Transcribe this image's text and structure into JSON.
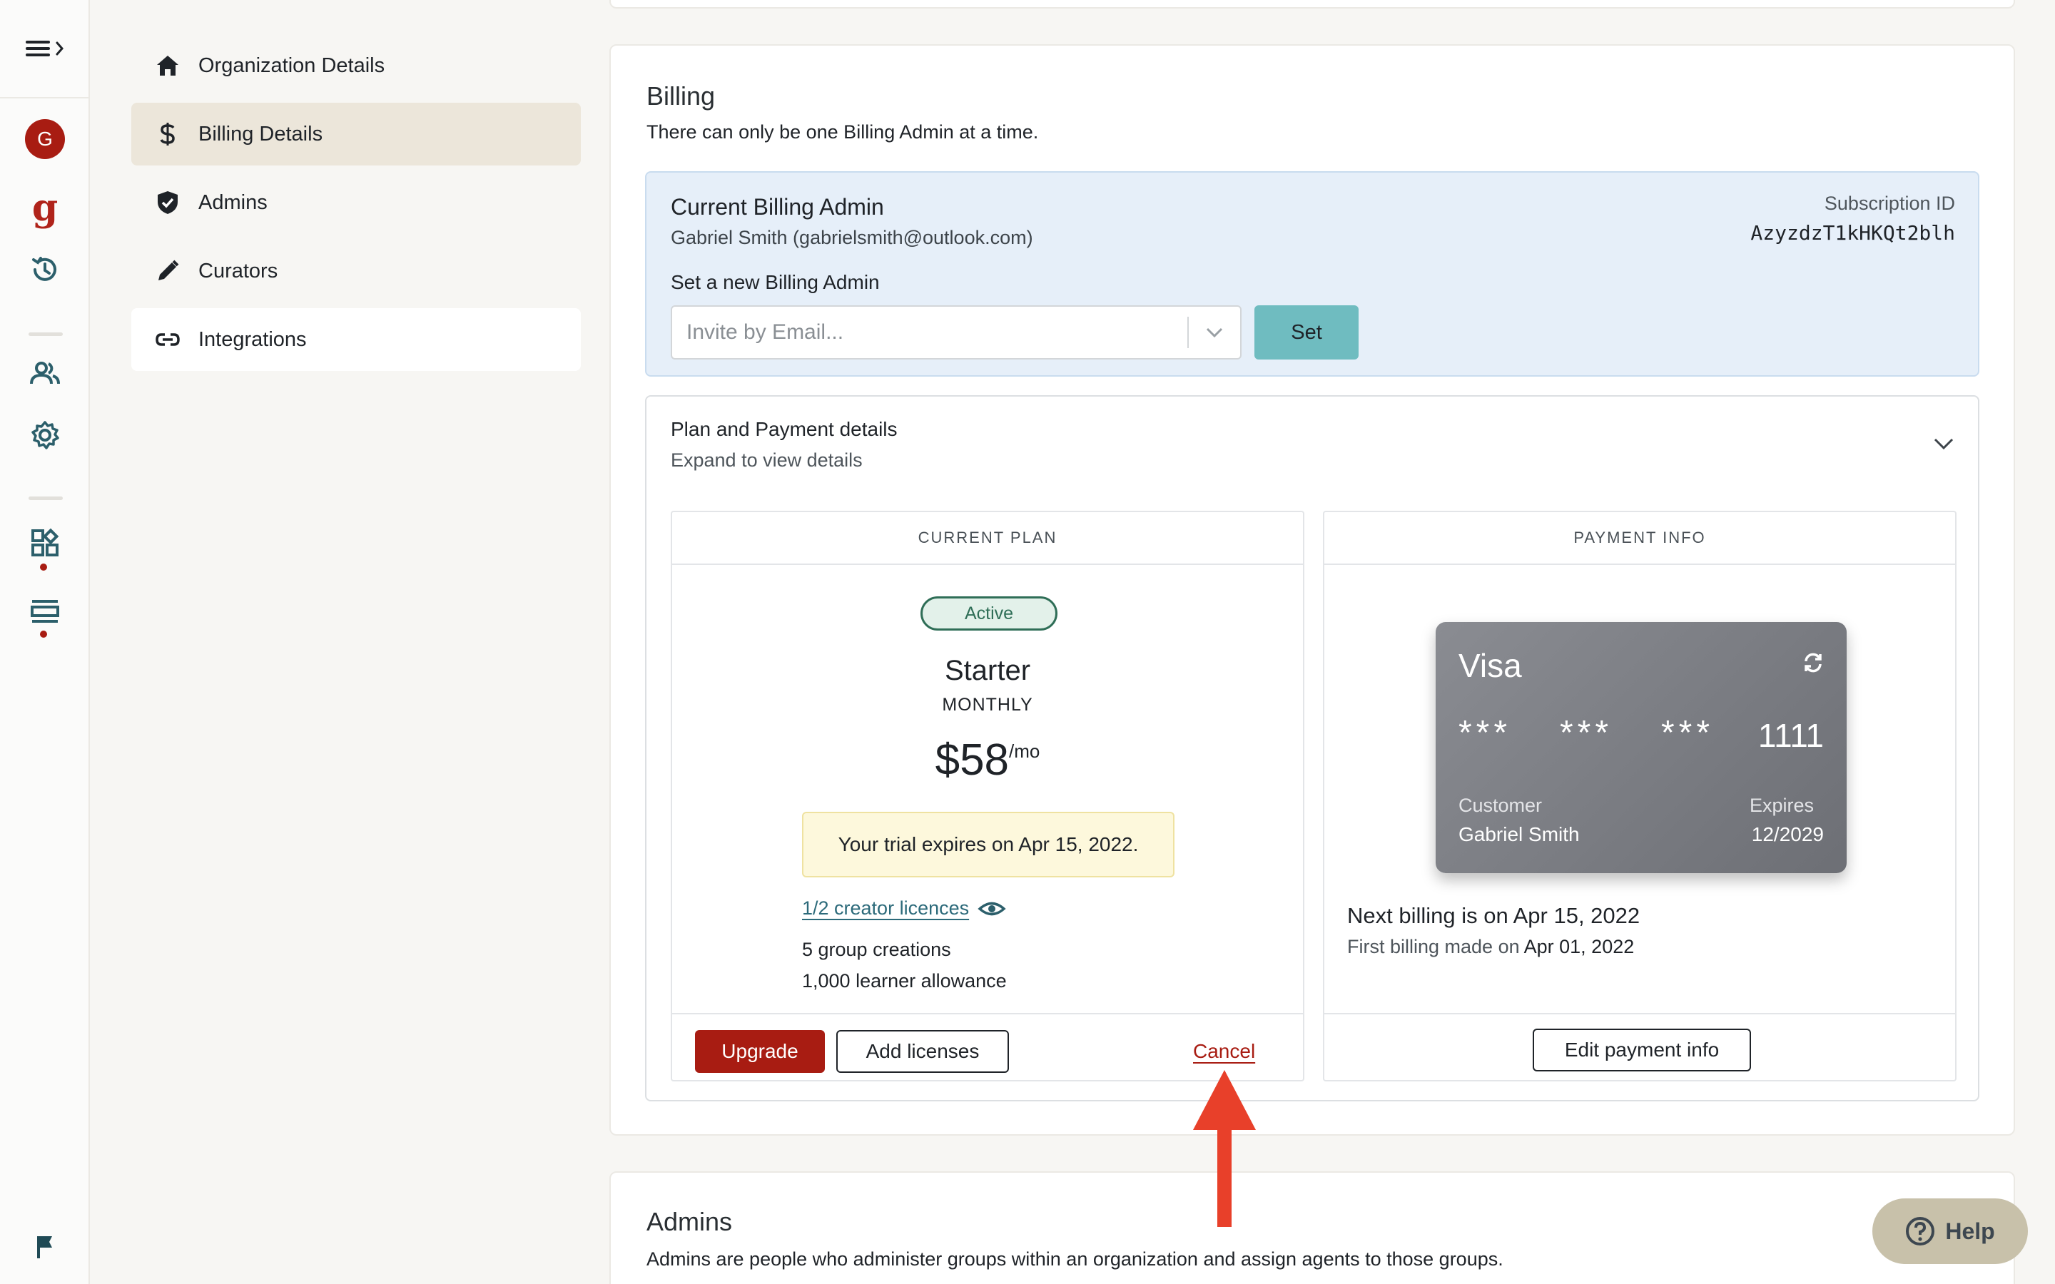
{
  "nav": {
    "items": [
      {
        "label": "Organization Details",
        "icon": "home-icon"
      },
      {
        "label": "Billing Details",
        "icon": "dollar-icon"
      },
      {
        "label": "Admins",
        "icon": "shield-icon"
      },
      {
        "label": "Curators",
        "icon": "pencil-icon"
      },
      {
        "label": "Integrations",
        "icon": "link-icon"
      }
    ]
  },
  "rail": {
    "avatar_letter": "G",
    "logo_letter": "g"
  },
  "billing": {
    "title": "Billing",
    "subtitle": "There can only be one Billing Admin at a time.",
    "current_admin_heading": "Current Billing Admin",
    "current_admin_value": "Gabriel Smith (gabrielsmith@outlook.com)",
    "subscription_id_label": "Subscription ID",
    "subscription_id_value": "AzyzdzT1kHKQt2blh",
    "set_new_label": "Set a new Billing Admin",
    "email_placeholder": "Invite by Email...",
    "set_button": "Set"
  },
  "plan": {
    "heading": "Plan and Payment details",
    "subheading": "Expand to view details",
    "current_plan_header": "CURRENT PLAN",
    "status": "Active",
    "name": "Starter",
    "period": "MONTHLY",
    "price": "$58",
    "price_unit": "/mo",
    "trial_notice": "Your trial expires on Apr 15, 2022.",
    "licences_link": "1/2 creator licences",
    "group_creations": "5 group creations",
    "learner_allowance": "1,000 learner allowance",
    "upgrade_button": "Upgrade",
    "add_licenses_button": "Add licenses",
    "cancel_link": "Cancel"
  },
  "payment": {
    "header": "PAYMENT INFO",
    "card_brand": "Visa",
    "masked_group_1": "***",
    "masked_group_2": "***",
    "masked_group_3": "***",
    "last_four": "1111",
    "customer_label": "Customer",
    "customer_name": "Gabriel Smith",
    "expires_label": "Expires",
    "expires_value": "12/2029",
    "next_billing_prefix": "Next billing is on",
    "next_billing_date": "Apr 15, 2022",
    "first_billing_prefix": "First billing made on",
    "first_billing_date": "Apr 01, 2022",
    "edit_button": "Edit payment info"
  },
  "admins_section": {
    "title": "Admins",
    "subtitle": "Admins are people who administer groups within an organization and assign agents to those groups."
  },
  "help": {
    "label": "Help"
  },
  "colors": {
    "brand_red": "#a81c12",
    "teal": "#6fbcc0",
    "annotation_arrow": "#e8402a"
  }
}
